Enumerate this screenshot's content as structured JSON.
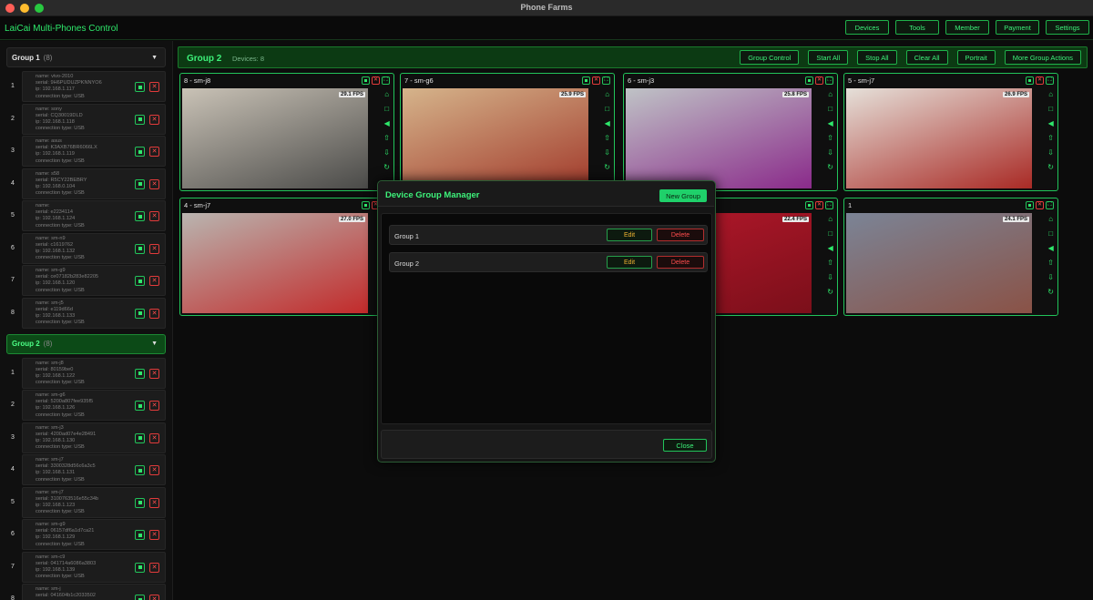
{
  "window": {
    "title": "Phone Farms"
  },
  "header": {
    "brand": "LaiCai Multi-Phones Control",
    "nav": [
      "Devices",
      "Tools",
      "Member",
      "Payment",
      "Settings"
    ]
  },
  "sidebar": {
    "groups": [
      {
        "name": "Group 1",
        "count": "(8)",
        "devices": [
          {
            "num": "1",
            "lines": [
              "name: vivo-2010",
              "serial: 9H6PUDUZPKNNYO6",
              "ip: 192.168.1.117",
              "connection type: USB"
            ]
          },
          {
            "num": "2",
            "lines": [
              "name: sony",
              "serial: CQ30019DLD",
              "ip: 192.168.1.118",
              "connection type: USB"
            ]
          },
          {
            "num": "3",
            "lines": [
              "name: asus",
              "serial: K3AXB76BR6066LX",
              "ip: 192.168.1.119",
              "connection type: USB"
            ]
          },
          {
            "num": "4",
            "lines": [
              "name: s58",
              "serial: R5CY22BEBRY",
              "ip: 192.168.0.104",
              "connection type: USB"
            ]
          },
          {
            "num": "5",
            "lines": [
              "name:",
              "serial: e2234114",
              "ip: 192.168.1.124",
              "connection type: USB"
            ]
          },
          {
            "num": "6",
            "lines": [
              "name: sm-n9",
              "serial: c1619762",
              "ip: 192.168.1.132",
              "connection type: USB"
            ]
          },
          {
            "num": "7",
            "lines": [
              "name: sm-g9",
              "serial: ce07182b283e82205",
              "ip: 192.168.1.120",
              "connection type: USB"
            ]
          },
          {
            "num": "8",
            "lines": [
              "name: sm-j5",
              "serial: e119d66d",
              "ip: 192.168.1.133",
              "connection type: USB"
            ]
          }
        ]
      },
      {
        "name": "Group 2",
        "count": "(8)",
        "devices": [
          {
            "num": "1",
            "lines": [
              "name: sm-j8",
              "serial: 80159be0",
              "ip: 192.168.1.122",
              "connection type: USB"
            ]
          },
          {
            "num": "2",
            "lines": [
              "name: sm-g6",
              "serial: 5200a807fee935f5",
              "ip: 192.168.1.126",
              "connection type: USB"
            ]
          },
          {
            "num": "3",
            "lines": [
              "name: sm-j3",
              "serial: 4200ad07e4e28491",
              "ip: 192.168.1.130",
              "connection type: USB"
            ]
          },
          {
            "num": "4",
            "lines": [
              "name: sm-j7",
              "serial: 3300328d56c6a3c5",
              "ip: 192.168.1.131",
              "connection type: USB"
            ]
          },
          {
            "num": "5",
            "lines": [
              "name: sm-j7",
              "serial: 3100763516e55c34b",
              "ip: 192.168.1.123",
              "connection type: USB"
            ]
          },
          {
            "num": "6",
            "lines": [
              "name: sm-g9",
              "serial: 06157df6a1d7ca21",
              "ip: 192.168.1.129",
              "connection type: USB"
            ]
          },
          {
            "num": "7",
            "lines": [
              "name: sm-c9",
              "serial: 041714a6086a3803",
              "ip: 192.168.1.139",
              "connection type: USB"
            ]
          },
          {
            "num": "8",
            "lines": [
              "name: sm-j",
              "serial: 041604b1c2033502"
            ]
          }
        ]
      }
    ]
  },
  "main": {
    "group_title": "Group 2",
    "devices_label": "Devices: 8",
    "actions": [
      "Group Control",
      "Start All",
      "Stop All",
      "Clear All",
      "Portrait",
      "More Group Actions"
    ],
    "cards": [
      {
        "title": "8 - sm-j8",
        "fps": "29.1 FPS",
        "c1": "#c9c2b6",
        "c2": "#4a4a48"
      },
      {
        "title": "7 - sm-g6",
        "fps": "25.9 FPS",
        "c1": "#d5b48b",
        "c2": "#a23b2c"
      },
      {
        "title": "6 - sm-j3",
        "fps": "25.8 FPS",
        "c1": "#bfc3c6",
        "c2": "#8a2a8a"
      },
      {
        "title": "5 - sm-j7",
        "fps": "26.9 FPS",
        "c1": "#e5e0d9",
        "c2": "#a92a25"
      },
      {
        "title": "4 - sm-j7",
        "fps": "27.0 FPS",
        "c1": "#b9b5b0",
        "c2": "#c22a2a"
      },
      {
        "title": "",
        "fps": "",
        "c1": "#333",
        "c2": "#333"
      },
      {
        "title": "",
        "fps": "22.4 FPS",
        "c1": "#b4182b",
        "c2": "#7b0f1a"
      },
      {
        "title": "1",
        "fps": "24.1 FPS",
        "c1": "#7b8496",
        "c2": "#8a5246"
      }
    ]
  },
  "modal": {
    "title": "Device Group Manager",
    "new_label": "New Group",
    "edit_label": "Edit",
    "delete_label": "Delete",
    "close_label": "Close",
    "groups": [
      "Group 1",
      "Group 2"
    ]
  }
}
